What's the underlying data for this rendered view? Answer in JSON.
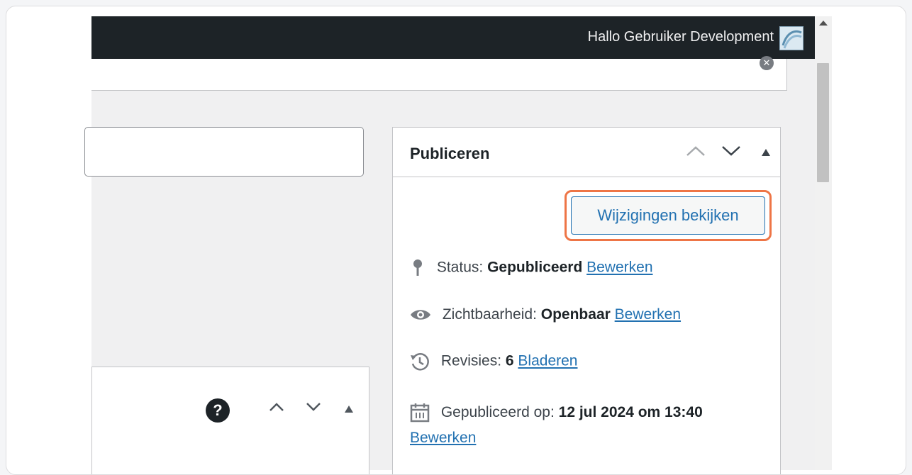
{
  "admin_bar": {
    "greeting": "Hallo Gebruiker Development"
  },
  "publish_box": {
    "title": "Publiceren",
    "preview_button": "Wijzigingen bekijken",
    "status": {
      "label": "Status:",
      "value": "Gepubliceerd",
      "link": "Bewerken"
    },
    "visibility": {
      "label": "Zichtbaarheid:",
      "value": "Openbaar",
      "link": "Bewerken"
    },
    "revisions": {
      "label": "Revisies:",
      "value": "6",
      "link": "Bladeren"
    },
    "published_on": {
      "label": "Gepubliceerd op:",
      "value": "12 jul 2024 om 13:40",
      "link": "Bewerken"
    }
  },
  "colors": {
    "admin_bar": "#1d2327",
    "link": "#2271b1",
    "highlight": "#ee7546"
  },
  "icons": [
    "user-avatar",
    "dismiss-icon",
    "help-icon",
    "arrow-up-icon",
    "arrow-down-icon",
    "toggle-triangle-icon",
    "pin-icon",
    "eye-icon",
    "history-icon",
    "calendar-icon"
  ]
}
